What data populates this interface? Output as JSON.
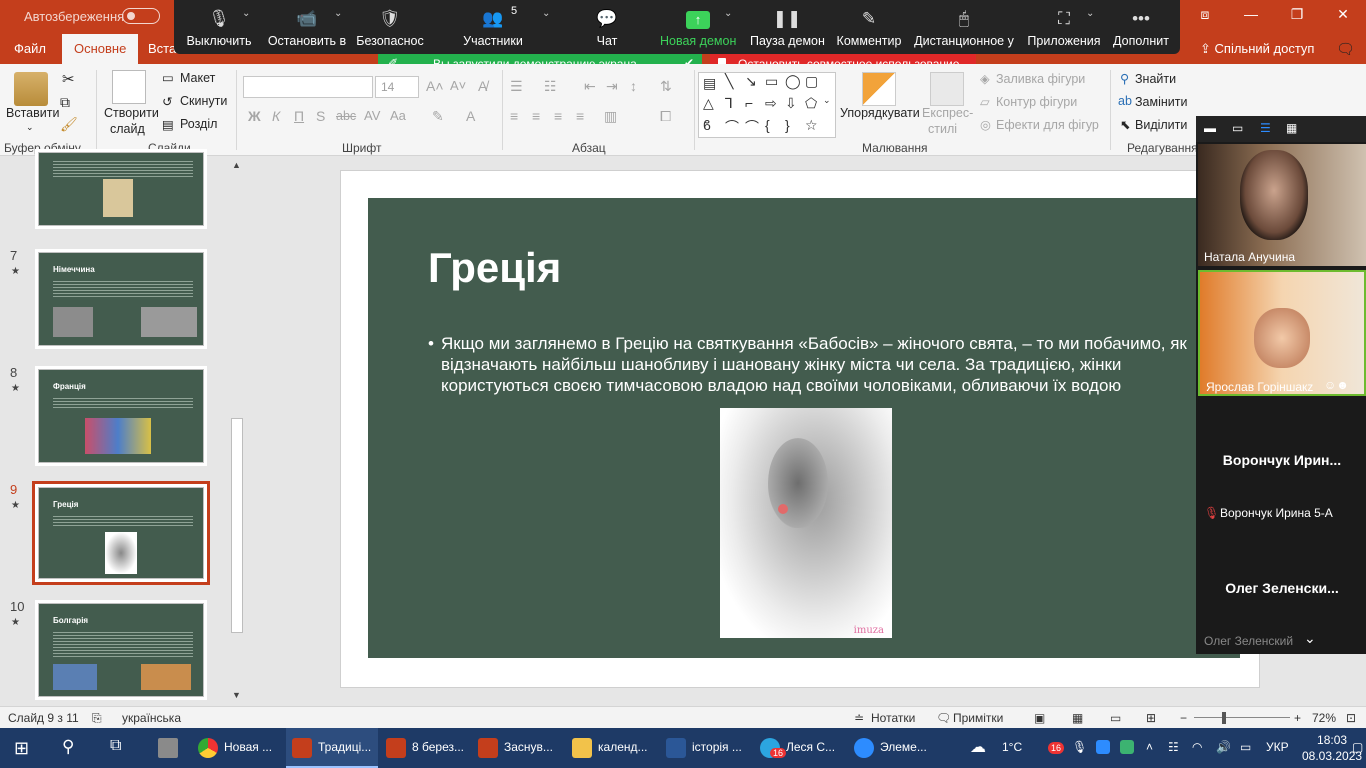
{
  "titlebar": {
    "autosave": "Автозбереження",
    "window_controls": [
      "⧈",
      "—",
      "❐",
      "✕"
    ]
  },
  "tabs": {
    "file": "Файл",
    "home": "Основне",
    "insert": "Вставл",
    "share": "Спільний доступ"
  },
  "zoom": {
    "mute": "Выключить",
    "stop_video": "Остановить в",
    "security": "Безопаснос",
    "participants": "Участники",
    "participants_count": "5",
    "chat": "Чат",
    "new_share": "Новая демон",
    "pause_share": "Пауза демон",
    "annotate": "Комментир",
    "remote_control": "Дистанционное у",
    "apps": "Приложения",
    "more": "Дополнит",
    "sharing_banner": "Вы запустили демонстрацию экрана",
    "stop_share": "Остановить совместное использование"
  },
  "ribbon": {
    "paste": "Вставити",
    "new_slide_1": "Створити",
    "new_slide_2": "слайд",
    "layout": "Макет",
    "reset": "Скинути",
    "section": "Розділ",
    "font_size": "14",
    "arrange": "Упорядкувати",
    "quick_styles_1": "Експрес-",
    "quick_styles_2": "стилі",
    "shape_fill": "Заливка фігури",
    "shape_outline": "Контур фігури",
    "shape_effects": "Ефекти для фігур",
    "find": "Знайти",
    "replace": "Замінити",
    "select": "Виділити",
    "groups": {
      "clipboard": "Буфер обміну",
      "slides": "Слайди",
      "font": "Шрифт",
      "paragraph": "Абзац",
      "drawing": "Малювання",
      "editing": "Редагування"
    }
  },
  "thumbnails": [
    {
      "num": "7",
      "title": "Німеччина"
    },
    {
      "num": "8",
      "title": "Франція"
    },
    {
      "num": "9",
      "title": "Греція"
    },
    {
      "num": "10",
      "title": "Болгарія"
    }
  ],
  "slide": {
    "title": "Греція",
    "body": "Якщо ми заглянемо в Грецію на святкування «Бабосів» – жіночого свята, – то ми побачимо, як відзначають найбільш шанобливу і шановану жінку міста чи села. За традицією, жінки користуються своєю тимчасовою владою над своїми чоловіками, обливаючи їх водою",
    "photo_watermark": "imuza"
  },
  "video_panel": {
    "p1": "Натала Анучина",
    "p2": "Ярослав Горіншакz",
    "p3_big": "Ворончук  Ирин...",
    "p3": "Ворончук Ирина 5-А",
    "p4_big": "Олег  Зеленски...",
    "p4": "Олег Зеленский"
  },
  "status": {
    "slide_info": "Слайд 9 з 11",
    "language": "українська",
    "notes": "Нотатки",
    "comments": "Примітки",
    "zoom_level": "72%"
  },
  "taskbar": {
    "items": [
      "Новая ...",
      "Традиці...",
      "8 берез...",
      "Заснув...",
      "календ...",
      "історія ...",
      "Леся С...",
      "Элеме..."
    ],
    "weather": "1°С",
    "lang": "УКР",
    "time": "18:03",
    "date": "08.03.2023",
    "badge": "16"
  }
}
